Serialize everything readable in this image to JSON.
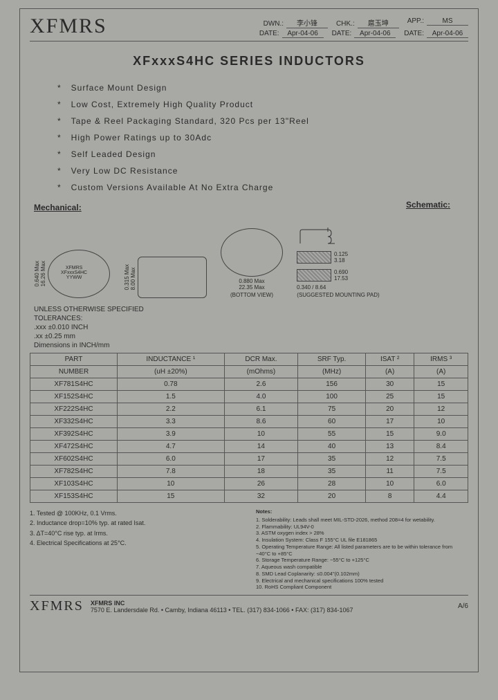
{
  "header": {
    "logo": "XFMRS",
    "dwn_label": "DWN.:",
    "dwn_value": "李小锋",
    "chk_label": "CHK.:",
    "chk_value": "扈玉坤",
    "app_label": "APP.:",
    "app_value": "MS",
    "date_label": "DATE:",
    "date_value": "Apr-04-06"
  },
  "title": "XFxxxS4HC  SERIES  INDUCTORS",
  "features": [
    "Surface Mount Design",
    "Low Cost, Extremely High Quality Product",
    "Tape & Reel Packaging Standard, 320 Pcs per 13\"Reel",
    "High Power Ratings up to 30Adc",
    "Self Leaded Design",
    "Very Low DC Resistance",
    "Custom Versions Available At No Extra Charge"
  ],
  "labels": {
    "schematic": "Schematic:",
    "mechanical": "Mechanical:",
    "bottom_view": "(BOTTOM VIEW)",
    "mount_pad": "(SUGGESTED MOUNTING PAD)"
  },
  "dimensions": {
    "B_in": "0.640 Max",
    "B_mm": "16.26 Max",
    "C_in": "0.315 Max",
    "C_mm": "8.00 Max",
    "A_in": "0.880 Max",
    "A_mm": "22.35 Max",
    "pad_h_in": "0.125",
    "pad_h_mm": "3.18",
    "pad_w_in": "0.340",
    "pad_w_mm": "8.64",
    "pad_gap_in": "0.690",
    "pad_gap_mm": "17.53"
  },
  "tolerances": {
    "line1": "UNLESS OTHERWISE SPECIFIED",
    "line2": "TOLERANCES:",
    "line3": ".xxx ±0.010 INCH",
    "line4": ".xx ±0.25 mm",
    "line5": "Dimensions in INCH/mm"
  },
  "table": {
    "headers_row1": [
      "PART",
      "INDUCTANCE ¹",
      "DCR Max.",
      "SRF Typ.",
      "ISAT ²",
      "IRMS ³"
    ],
    "headers_row2": [
      "NUMBER",
      "(uH ±20%)",
      "(mOhms)",
      "(MHz)",
      "(A)",
      "(A)"
    ],
    "rows": [
      [
        "XF781S4HC",
        "0.78",
        "2.6",
        "156",
        "30",
        "15"
      ],
      [
        "XF152S4HC",
        "1.5",
        "4.0",
        "100",
        "25",
        "15"
      ],
      [
        "XF222S4HC",
        "2.2",
        "6.1",
        "75",
        "20",
        "12"
      ],
      [
        "XF332S4HC",
        "3.3",
        "8.6",
        "60",
        "17",
        "10"
      ],
      [
        "XF392S4HC",
        "3.9",
        "10",
        "55",
        "15",
        "9.0"
      ],
      [
        "XF472S4HC",
        "4.7",
        "14",
        "40",
        "13",
        "8.4"
      ],
      [
        "XF602S4HC",
        "6.0",
        "17",
        "35",
        "12",
        "7.5"
      ],
      [
        "XF782S4HC",
        "7.8",
        "18",
        "35",
        "11",
        "7.5"
      ],
      [
        "XF103S4HC",
        "10",
        "26",
        "28",
        "10",
        "6.0"
      ],
      [
        "XF153S4HC",
        "15",
        "32",
        "20",
        "8",
        "4.4"
      ]
    ]
  },
  "footnotes_left": [
    "1. Tested @ 100KHz, 0.1 Vrms.",
    "2. Inductance drop=10% typ. at rated Isat.",
    "3. ΔT=40°C rise typ. at Irms.",
    "4. Electrical Specifications at 25°C."
  ],
  "notes_header": "Notes:",
  "notes_right": [
    "1. Solderability: Leads shall meet MIL-STD-2026, method 208=4 for wetability.",
    "2. Flammability: UL94V-0",
    "3. ASTM oxygen index > 28%",
    "4. Insulation System: Class F 155°C UL file E181865",
    "5. Operating Temperature Range: All listed parameters are to be within tolerance from −40°C to +85°C",
    "6. Storage Temperature Range: −55°C to +125°C",
    "7. Aqueous wash compatible",
    "8. SMD Lead Coplanarity: ≤0.004\"(0.102mm)",
    "9. Electrical and mechanical specifications 100% tested",
    "10. RoHS Compliant Component"
  ],
  "footer": {
    "logo": "XFMRS",
    "company": "XFMRS INC",
    "address": "7570 E. Landersdale Rd. • Camby, Indiana 46113 • TEL. (317) 834-1066 • FAX: (317) 834-1067",
    "page": "A/6"
  }
}
